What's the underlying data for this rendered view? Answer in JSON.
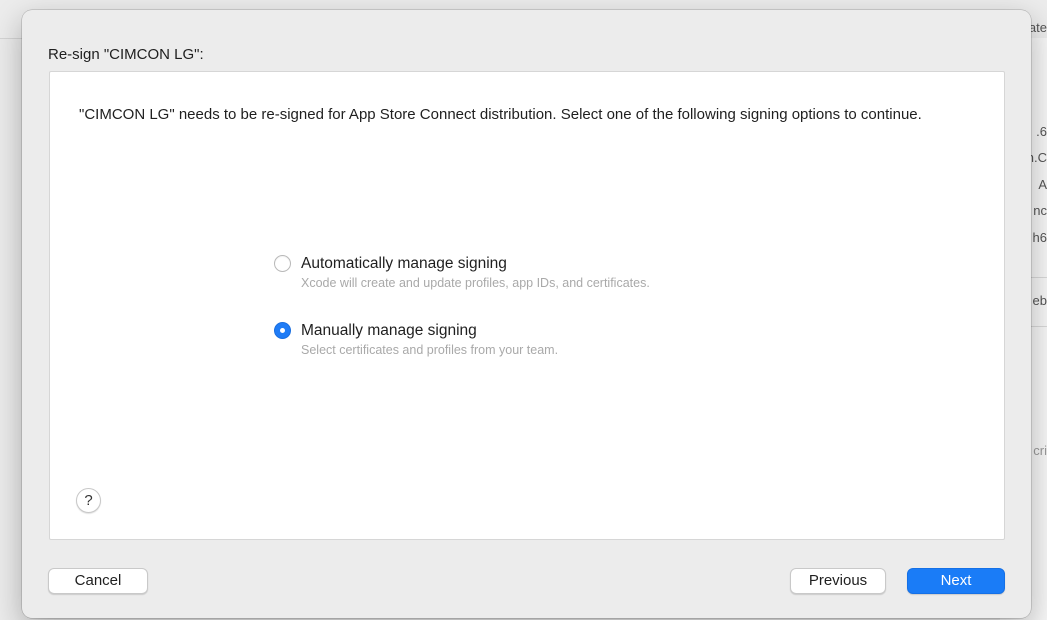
{
  "background": {
    "fragments": [
      ".6",
      "n.C",
      "A",
      "nc",
      "h6",
      "eb",
      "cri",
      "ate"
    ]
  },
  "dialog": {
    "title": "Re-sign \"CIMCON LG\":",
    "description": "\"CIMCON LG\" needs to be re-signed for App Store Connect distribution. Select one of the following signing options to continue.",
    "options": [
      {
        "label": "Automatically manage signing",
        "description": "Xcode will create and update profiles, app IDs, and certificates.",
        "selected": false
      },
      {
        "label": "Manually manage signing",
        "description": "Select certificates and profiles from your team.",
        "selected": true
      }
    ],
    "help_label": "?",
    "buttons": {
      "cancel": "Cancel",
      "previous": "Previous",
      "next": "Next"
    }
  },
  "colors": {
    "accent": "#1a7cf7"
  }
}
